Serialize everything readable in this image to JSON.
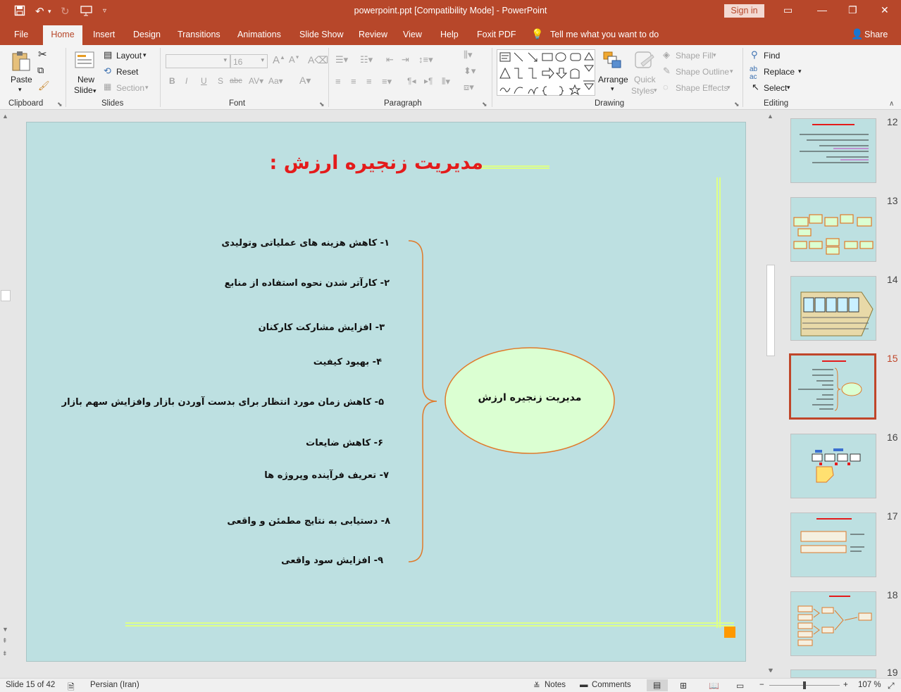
{
  "window": {
    "doc_title": "powerpoint.ppt [Compatibility Mode]  -  PowerPoint",
    "sign_in": "Sign in"
  },
  "tabs": [
    "File",
    "Home",
    "Insert",
    "Design",
    "Transitions",
    "Animations",
    "Slide Show",
    "Review",
    "View",
    "Help",
    "Foxit PDF"
  ],
  "tell_me": "Tell me what you want to do",
  "share": "Share",
  "ribbon": {
    "clipboard": {
      "paste": "Paste",
      "label": "Clipboard"
    },
    "slides": {
      "new_slide": "New",
      "new_slide2": "Slide",
      "layout": "Layout",
      "reset": "Reset",
      "section": "Section",
      "label": "Slides"
    },
    "font": {
      "size": "16",
      "label": "Font"
    },
    "paragraph": {
      "label": "Paragraph"
    },
    "drawing": {
      "arrange": "Arrange",
      "quick_styles": "Quick",
      "quick_styles2": "Styles",
      "shape_fill": "Shape Fill",
      "shape_outline": "Shape Outline",
      "shape_effects": "Shape Effects",
      "label": "Drawing"
    },
    "editing": {
      "find": "Find",
      "replace": "Replace",
      "select": "Select",
      "label": "Editing"
    }
  },
  "slide": {
    "title": "مدیریت زنجیره ارزش  :",
    "ellipse_text": "مدیریت زنجیره ارزش",
    "items": [
      "۱- کاهش هزینه های عملیاتی وتولیدی",
      "۲- کارآتر شدن نحوه استفاده از منابع",
      "۳- افزایش مشارکت کارکنان",
      "۴- بهبود کیفیت",
      "۵- کاهش زمان مورد انتظار برای بدست آوردن بازار وافزایش سهم بازار",
      "۶- کاهش ضایعات",
      "۷- تعریف فرآینده وپروژه ها",
      "۸- دستیابی به نتایج مطمئن و واقعی",
      "۹- افزایش سود واقعی"
    ]
  },
  "thumbnails": [
    "12",
    "13",
    "14",
    "15",
    "16",
    "17",
    "18",
    "19"
  ],
  "active_thumbnail": "15",
  "status": {
    "slide_info": "Slide 15 of 42",
    "language": "Persian (Iran)",
    "notes": "Notes",
    "comments": "Comments",
    "zoom": "107 %"
  },
  "colors": {
    "accent": "#b7472a",
    "slide_bg": "#bde0e1",
    "title_red": "#e41b1b",
    "ellipse_fill": "#dbffd2",
    "brace": "#e07a2a",
    "lime_line": "#ddff88"
  }
}
